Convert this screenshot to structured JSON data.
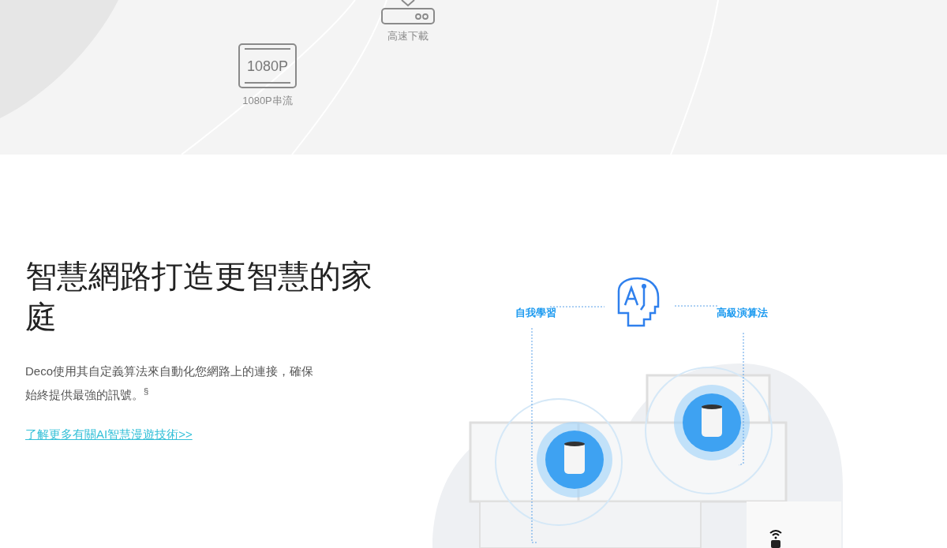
{
  "hero_features": [
    {
      "kind": "screen",
      "icon_text": "1080P",
      "label": "1080P串流"
    },
    {
      "kind": "router",
      "label": "高速下載"
    }
  ],
  "section": {
    "heading": "智慧網路打造更智慧的家庭",
    "paragraph": "Deco使用其自定義算法來自動化您網路上的連接，確保始終提供最強的訊號。$^{§}$",
    "link": "了解更多有關AI智慧漫遊技術>>"
  },
  "diagram": {
    "left_label": "自我學習",
    "right_label": "高級演算法"
  }
}
